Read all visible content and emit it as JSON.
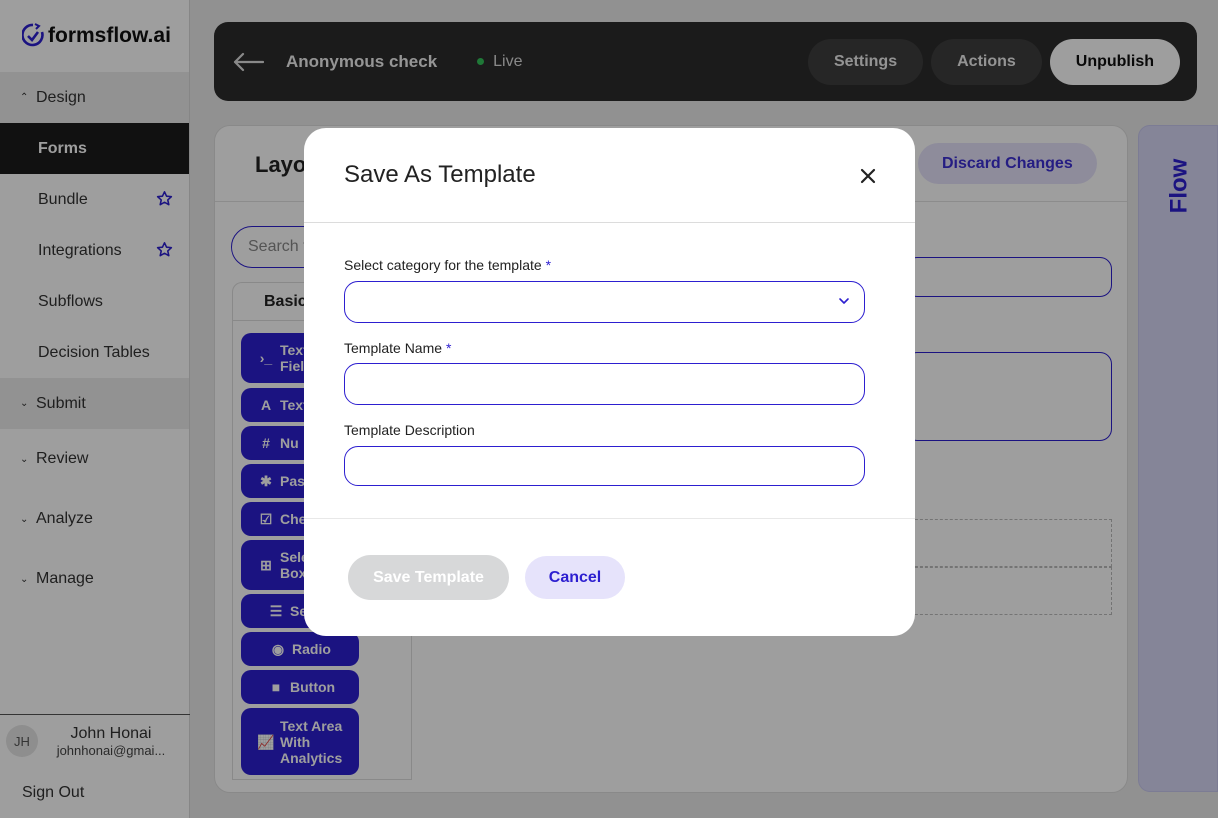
{
  "sidebar": {
    "brand": "formsflow.ai",
    "sections": [
      {
        "label": "Design"
      },
      {
        "label": "Submit"
      },
      {
        "label": "Review"
      },
      {
        "label": "Analyze"
      },
      {
        "label": "Manage"
      }
    ],
    "design_items": [
      {
        "label": "Forms"
      },
      {
        "label": "Bundle"
      },
      {
        "label": "Integrations"
      },
      {
        "label": "Subflows"
      },
      {
        "label": "Decision Tables"
      }
    ],
    "user": {
      "initials": "JH",
      "name": "John Honai",
      "email": "johnhonai@gmai..."
    },
    "sign_out": "Sign Out"
  },
  "header": {
    "form_title": "Anonymous check",
    "status": "Live",
    "settings_label": "Settings",
    "actions_label": "Actions",
    "unpublish_label": "Unpublish"
  },
  "builder": {
    "layout_title": "Layo",
    "discard_label": "Discard Changes",
    "search_placeholder": "Search f",
    "tab_label": "Basic",
    "components": [
      {
        "icon": "terminal-icon",
        "label": "Text\nField"
      },
      {
        "icon": "font-icon",
        "label": "Text"
      },
      {
        "icon": "hash-icon",
        "label": "Nu"
      },
      {
        "icon": "asterisk-icon",
        "label": "Pass"
      },
      {
        "icon": "checkbox-icon",
        "label": "Chec"
      },
      {
        "icon": "plus-square-icon",
        "label": "Selec\nBoxe"
      },
      {
        "icon": "list-icon",
        "label": "Se"
      },
      {
        "icon": "radio-icon",
        "label": "Radio"
      },
      {
        "icon": "stop-icon",
        "label": "Button"
      },
      {
        "icon": "chart-icon",
        "label": "Text Area\nWith\nAnalytics"
      }
    ]
  },
  "flow_panel": {
    "label": "Flow"
  },
  "modal": {
    "title": "Save As Template",
    "category_label": "Select category for the template",
    "name_label": "Template Name",
    "description_label": "Template Description",
    "required_mark": "*",
    "save_label": "Save Template",
    "cancel_label": "Cancel"
  },
  "colors": {
    "accent": "#2d1fd0",
    "accent_light": "#e6e3fb",
    "header_bg": "#2c2c2c",
    "live_dot": "#33c25a",
    "disabled_btn": "#d7d8d9"
  }
}
